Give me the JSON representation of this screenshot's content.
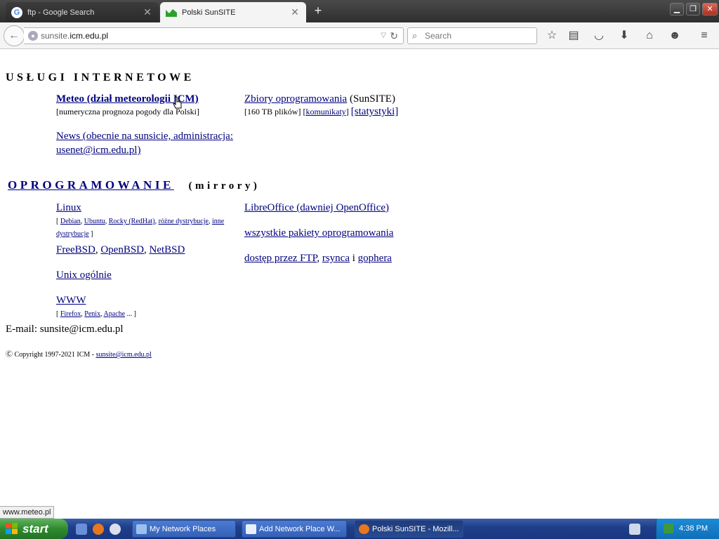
{
  "browser": {
    "tabs": [
      {
        "title": "ftp - Google Search",
        "icon": "google-icon"
      },
      {
        "title": "Polski SunSITE",
        "icon": "sunsite-icon"
      }
    ],
    "url": {
      "prefix": "sunsite.",
      "host": "icm.edu.pl"
    },
    "search_placeholder": "Search"
  },
  "page": {
    "services": {
      "heading": "USŁUGI INTERNETOWE",
      "meteo": {
        "link": "Meteo (dział meteorologii ICM)",
        "desc": "[numeryczna prognoza pogody dla Polski]"
      },
      "news": {
        "link": "News (obecnie na sunsicie, administracja: usenet@icm.edu.pl)"
      },
      "software_collections": {
        "link": "Zbiory oprogramowania",
        "suffix": " (SunSITE)",
        "size": "[160 TB plików] [",
        "messages": "komunikaty",
        "sep": "] ",
        "stats": "[statystyki]"
      }
    },
    "software": {
      "heading": "OPROGRAMOWANIE",
      "subheading": "(mirrory)",
      "linux": {
        "link": "Linux",
        "open": "[ ",
        "items": [
          "Debian",
          "Ubuntu",
          "Rocky (RedHat)",
          "różne dystrybucje",
          "inne dystrybucje"
        ],
        "comma": ", ",
        "close": " ]"
      },
      "bsd": {
        "items": [
          "FreeBSD",
          "OpenBSD",
          "NetBSD"
        ],
        "comma": ", "
      },
      "unix": "Unix ogólnie",
      "www": {
        "link": "WWW",
        "open": "[ ",
        "items": [
          "Firefox",
          "Penix",
          "Apache"
        ],
        "comma": ", ",
        "ellipsis": " ... ]"
      },
      "libreoffice": "LibreOffice (dawniej OpenOffice)",
      "all_packages": "wszystkie pakiety oprogramowania",
      "access": {
        "ftp": "dostęp przez FTP",
        "comma": ", ",
        "rsync": "rsynca",
        "and": " i ",
        "gopher": "gophera"
      }
    },
    "email": "E-mail: sunsite@icm.edu.pl",
    "copyright": {
      "text": "Copyright 1997-2021 ICM - ",
      "link": "sunsite@icm.edu.pl"
    }
  },
  "status_url": "www.meteo.pl",
  "taskbar": {
    "start": "start",
    "tasks": [
      "My Network Places",
      "Add Network Place W...",
      "Polski SunSITE - Mozill..."
    ],
    "clock": "4:38 PM"
  },
  "colors": {
    "link": "#00007f",
    "visited": "#00007f",
    "taskbar": "#1f3f8a",
    "start": "#2f8a2f"
  }
}
